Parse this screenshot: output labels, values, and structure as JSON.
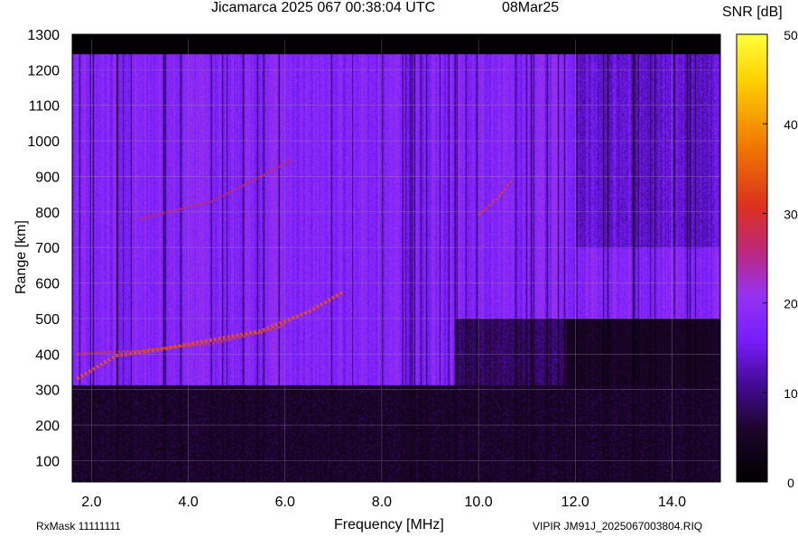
{
  "header": {
    "title": "Jicamarca 2025 067 00:38:04 UTC",
    "date": "08Mar25",
    "colorbar_label": "SNR [dB]"
  },
  "footer": {
    "rx_mask": "RxMask 11111111",
    "file_info": "VIPIR  JM91J_2025067003804.RIQ"
  },
  "chart_data": {
    "type": "heatmap",
    "title": "Jicamarca 2025 067 00:38:04 UTC",
    "xlabel": "Frequency [MHz]",
    "ylabel": "Range [km]",
    "xlim": [
      1.6,
      15.0
    ],
    "ylim": [
      40,
      1300
    ],
    "x_ticks": [
      "2.0",
      "4.0",
      "6.0",
      "8.0",
      "10.0",
      "12.0",
      "14.0"
    ],
    "x_tick_values": [
      2,
      4,
      6,
      8,
      10,
      12,
      14
    ],
    "y_ticks": [
      "100",
      "200",
      "300",
      "400",
      "500",
      "600",
      "700",
      "800",
      "900",
      "1000",
      "1100",
      "1200",
      "1300"
    ],
    "y_tick_values": [
      100,
      200,
      300,
      400,
      500,
      600,
      700,
      800,
      900,
      1000,
      1100,
      1200,
      1300
    ],
    "grid": true,
    "colorbar": {
      "label": "SNR [dB]",
      "range": [
        0,
        50
      ],
      "ticks": [
        "0",
        "10",
        "20",
        "30",
        "40",
        "50"
      ],
      "tick_values": [
        0,
        10,
        20,
        30,
        40,
        50
      ],
      "colormap": [
        "#000000",
        "#2a0a4a",
        "#5a10c8",
        "#8a20ff",
        "#c0207a",
        "#e03020",
        "#f07a00",
        "#ffd000",
        "#ffff40"
      ]
    },
    "traces": [
      {
        "name": "o-trace",
        "points": [
          [
            1.7,
            330
          ],
          [
            2.5,
            395
          ],
          [
            3.5,
            415
          ],
          [
            4.5,
            440
          ],
          [
            5.5,
            465
          ],
          [
            6.5,
            520
          ],
          [
            7.2,
            575
          ]
        ]
      },
      {
        "name": "x-trace",
        "points": [
          [
            1.7,
            400
          ],
          [
            3.0,
            410
          ],
          [
            4.5,
            430
          ],
          [
            5.5,
            460
          ],
          [
            6.0,
            480
          ]
        ]
      },
      {
        "name": "multi-hop",
        "points": [
          [
            3.0,
            780
          ],
          [
            4.5,
            830
          ],
          [
            5.5,
            900
          ],
          [
            6.2,
            950
          ]
        ]
      },
      {
        "name": "oblique",
        "points": [
          [
            10.0,
            790
          ],
          [
            10.4,
            840
          ],
          [
            10.7,
            890
          ]
        ]
      }
    ]
  }
}
